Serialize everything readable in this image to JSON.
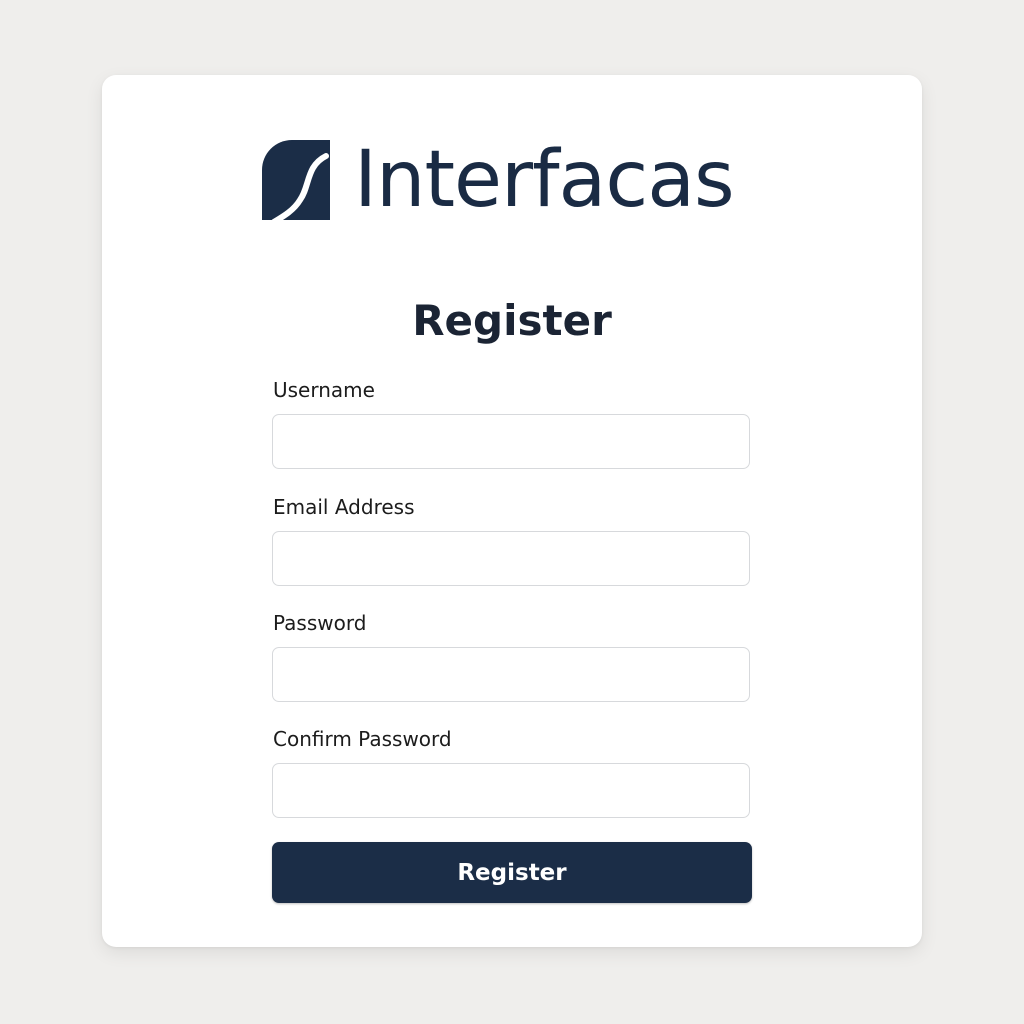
{
  "brand": {
    "name": "Interfacas",
    "logo_icon": "interfacas-logo-icon",
    "color": "#1a2b44"
  },
  "form": {
    "title": "Register",
    "fields": [
      {
        "label": "Username",
        "value": "",
        "placeholder": ""
      },
      {
        "label": "Email Address",
        "value": "",
        "placeholder": ""
      },
      {
        "label": "Password",
        "value": "",
        "placeholder": ""
      },
      {
        "label": "Confirm Password",
        "value": "",
        "placeholder": ""
      }
    ],
    "submit_label": "Register",
    "submit_color": "#1b2d47"
  }
}
